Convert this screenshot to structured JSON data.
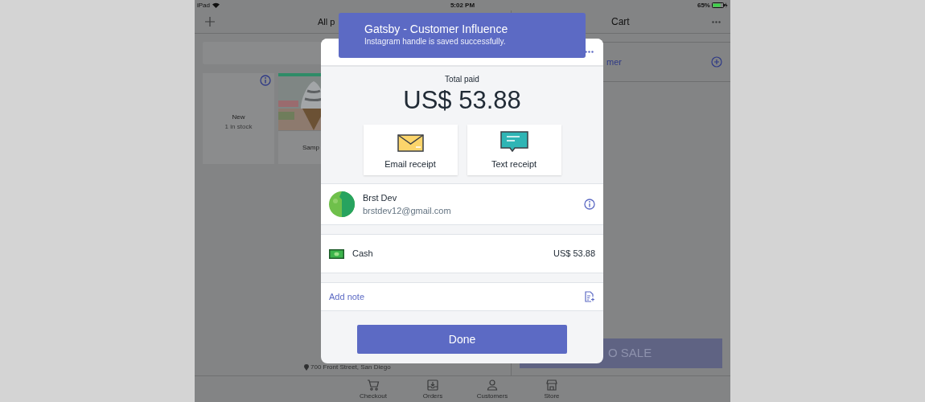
{
  "status_bar": {
    "device": "iPad",
    "time": "5:02 PM",
    "battery": "65%"
  },
  "products_pane": {
    "title": "All p",
    "tiles": [
      {
        "kind": "text",
        "name": "New",
        "stock": "1 in stock"
      },
      {
        "kind": "picture",
        "name": "Samp"
      }
    ],
    "address": "700 Front Street, San Diego"
  },
  "cart_pane": {
    "title": "Cart",
    "add_customer": "mer",
    "sale_button": "O SALE"
  },
  "tab_bar": [
    {
      "kind": "cart",
      "label": "Checkout"
    },
    {
      "kind": "inbox",
      "label": "Orders"
    },
    {
      "kind": "person",
      "label": "Customers"
    },
    {
      "kind": "store",
      "label": "Store"
    }
  ],
  "toast": {
    "title": "Gatsby - Customer Influence",
    "message": "Instagram handle is saved successfully."
  },
  "modal": {
    "total_label": "Total paid",
    "total": "US$ 53.88",
    "receipts": [
      {
        "kind": "email",
        "label": "Email receipt"
      },
      {
        "kind": "text",
        "label": "Text receipt"
      }
    ],
    "customer": {
      "name": "Brst Dev",
      "email": "brstdev12@gmail.com"
    },
    "payment": {
      "method": "Cash",
      "amount": "US$ 53.88"
    },
    "note_link": "Add note",
    "done_button": "Done"
  }
}
